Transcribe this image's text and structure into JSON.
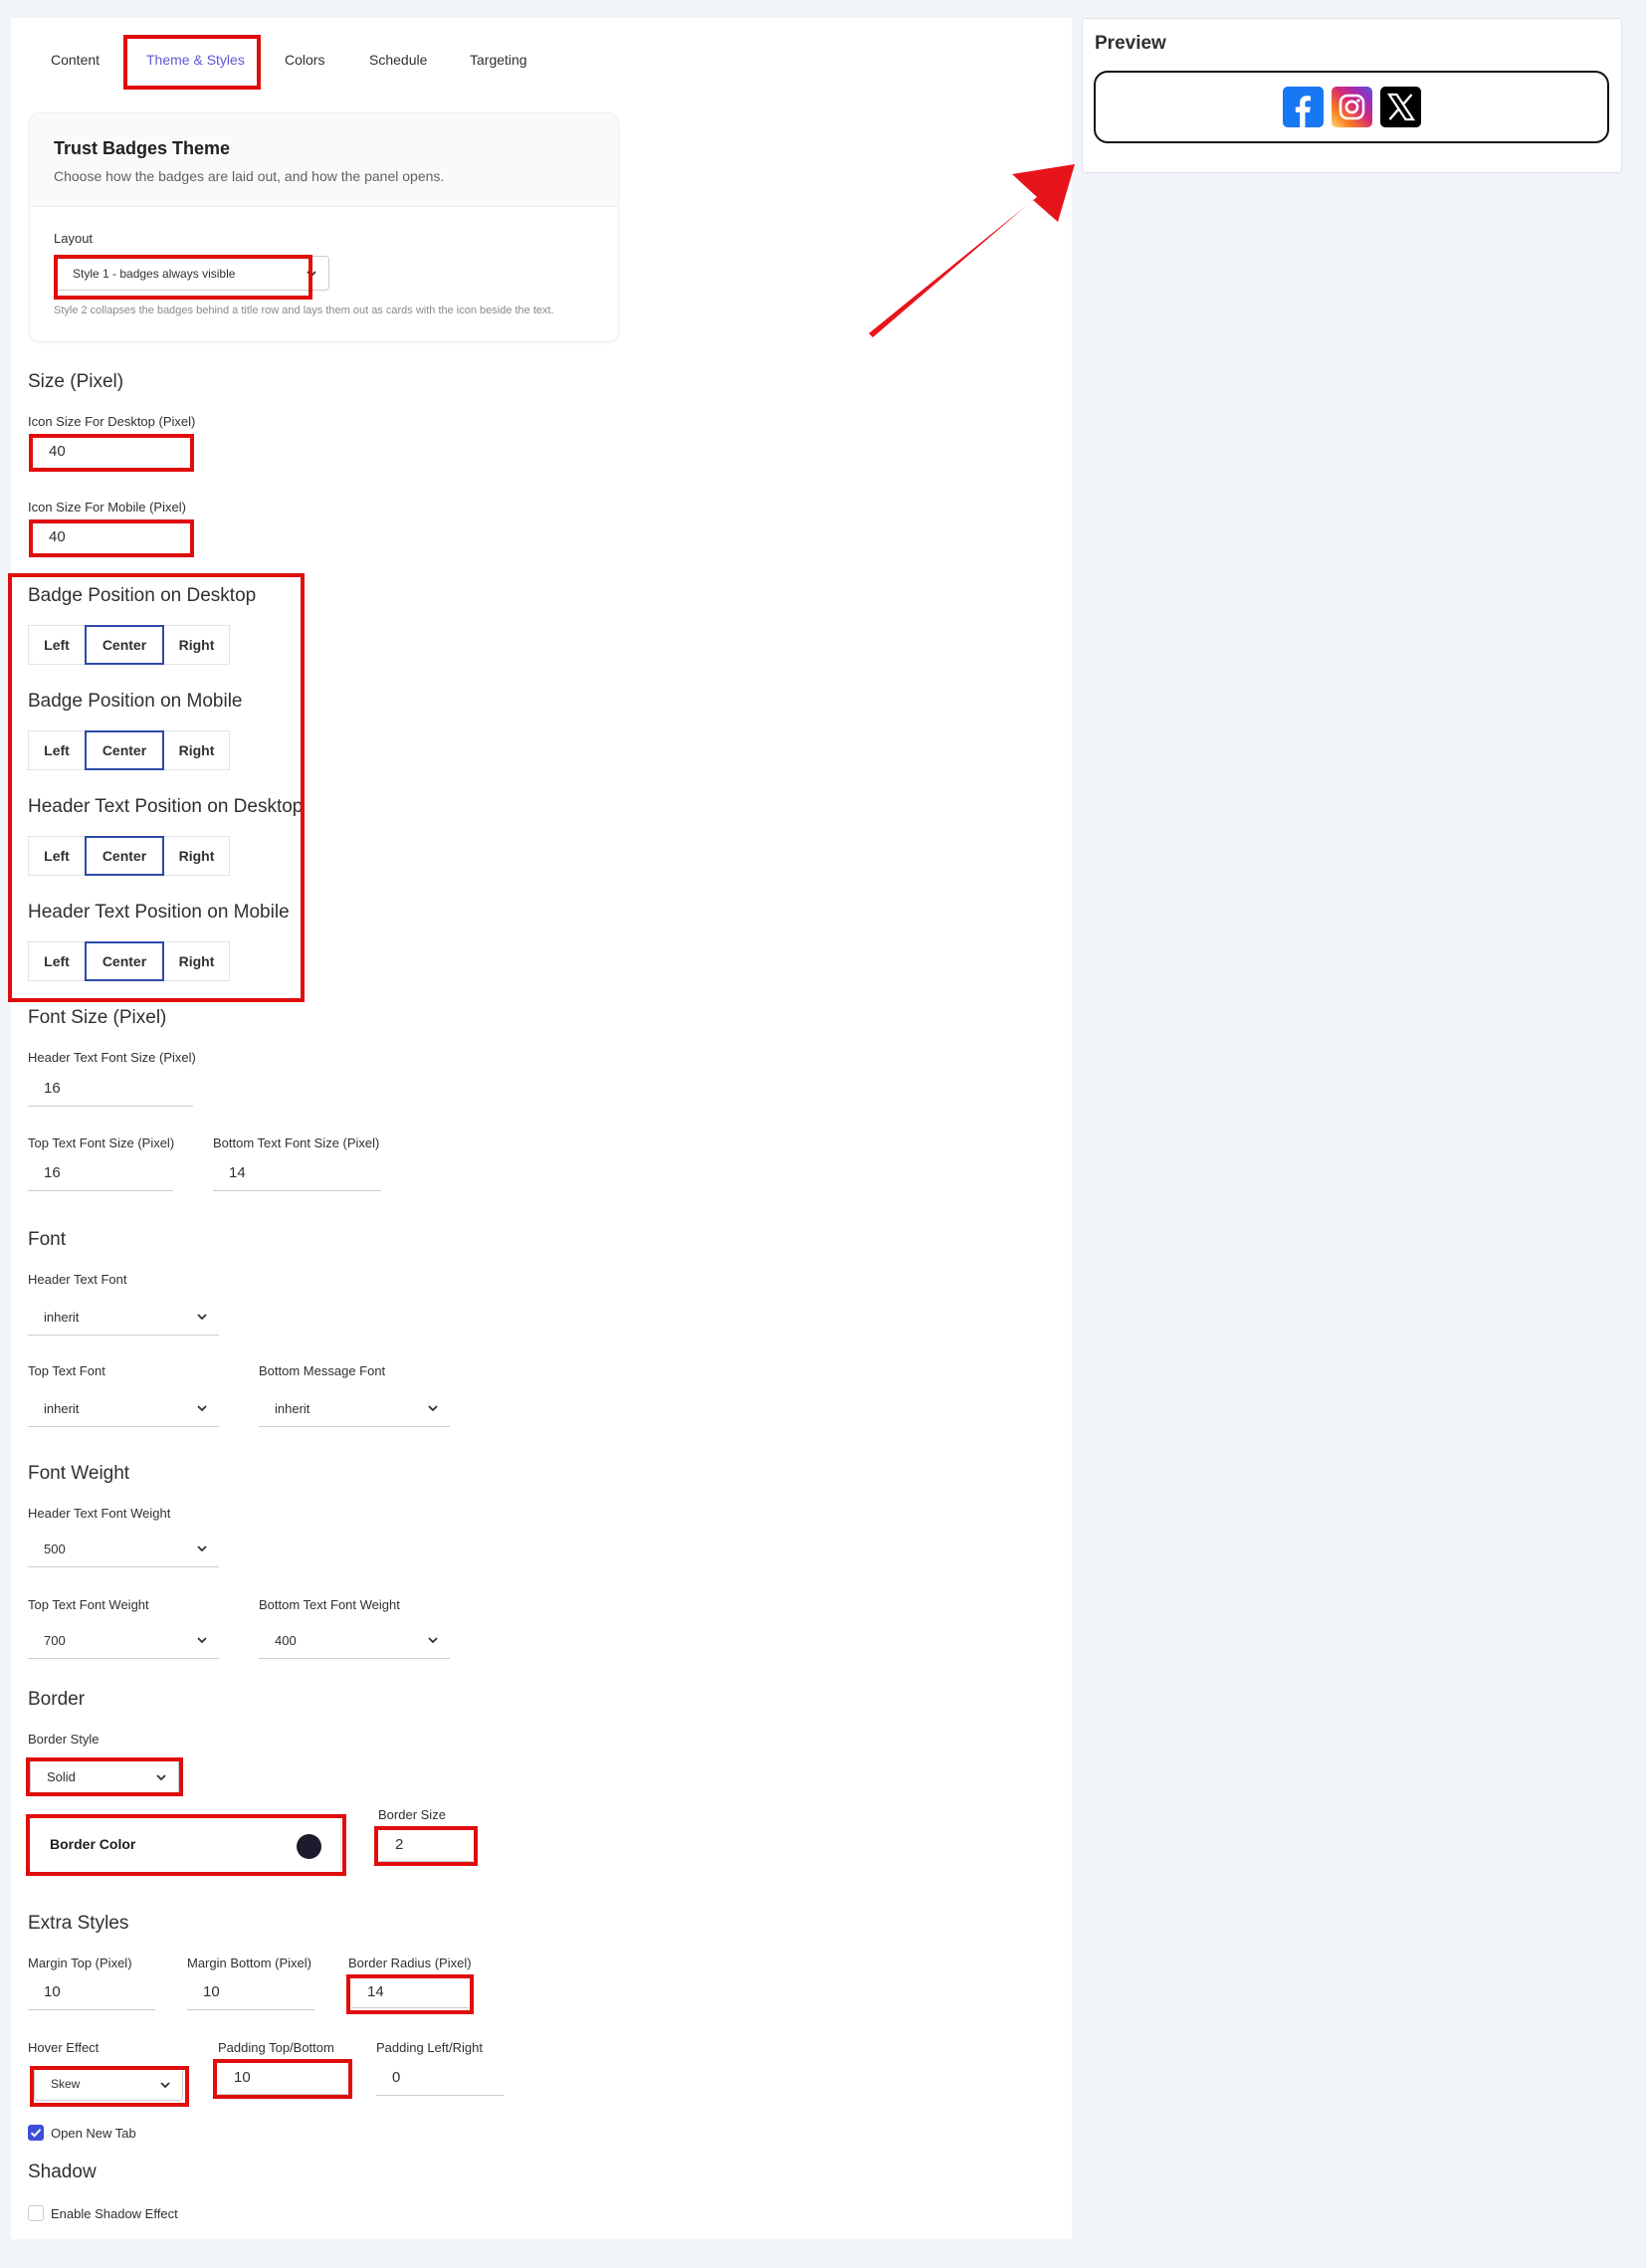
{
  "tabs": [
    {
      "label": "Content"
    },
    {
      "label": "Theme & Styles",
      "active": true
    },
    {
      "label": "Colors"
    },
    {
      "label": "Schedule"
    },
    {
      "label": "Targeting"
    }
  ],
  "theme_card": {
    "title": "Trust Badges Theme",
    "description": "Choose how the badges are laid out, and how the panel opens.",
    "layout_label": "Layout",
    "layout_value": "Style 1 - badges always visible",
    "layout_help": "Style 2 collapses the badges behind a title row and lays them out as cards with the icon beside the text."
  },
  "size": {
    "heading": "Size (Pixel)",
    "desktop_label": "Icon Size For Desktop (Pixel)",
    "desktop_value": "40",
    "mobile_label": "Icon Size For Mobile (Pixel)",
    "mobile_value": "40"
  },
  "positions": [
    {
      "heading": "Badge Position on Desktop",
      "options": [
        "Left",
        "Center",
        "Right"
      ],
      "selected": "Center"
    },
    {
      "heading": "Badge Position on Mobile",
      "options": [
        "Left",
        "Center",
        "Right"
      ],
      "selected": "Center"
    },
    {
      "heading": "Header Text Position on Desktop",
      "options": [
        "Left",
        "Center",
        "Right"
      ],
      "selected": "Center"
    },
    {
      "heading": "Header Text Position on Mobile",
      "options": [
        "Left",
        "Center",
        "Right"
      ],
      "selected": "Center"
    }
  ],
  "font_size": {
    "heading": "Font Size (Pixel)",
    "header_label": "Header Text Font Size (Pixel)",
    "header_value": "16",
    "top_label": "Top Text Font Size (Pixel)",
    "top_value": "16",
    "bottom_label": "Bottom Text Font Size (Pixel)",
    "bottom_value": "14"
  },
  "font": {
    "heading": "Font",
    "header_label": "Header Text Font",
    "header_value": "inherit",
    "top_label": "Top Text Font",
    "top_value": "inherit",
    "bottom_label": "Bottom Message Font",
    "bottom_value": "inherit"
  },
  "font_weight": {
    "heading": "Font Weight",
    "header_label": "Header Text Font Weight",
    "header_value": "500",
    "top_label": "Top Text Font Weight",
    "top_value": "700",
    "bottom_label": "Bottom Text Font Weight",
    "bottom_value": "400"
  },
  "border": {
    "heading": "Border",
    "style_label": "Border Style",
    "style_value": "Solid",
    "color_label": "Border Color",
    "color_value": "#1c1a2c",
    "size_label": "Border Size",
    "size_value": "2"
  },
  "extra": {
    "heading": "Extra Styles",
    "margin_top_label": "Margin Top (Pixel)",
    "margin_top_value": "10",
    "margin_bottom_label": "Margin Bottom (Pixel)",
    "margin_bottom_value": "10",
    "radius_label": "Border Radius (Pixel)",
    "radius_value": "14",
    "hover_label": "Hover Effect",
    "hover_value": "Skew",
    "pad_tb_label": "Padding Top/Bottom",
    "pad_tb_value": "10",
    "pad_lr_label": "Padding Left/Right",
    "pad_lr_value": "0",
    "new_tab_label": "Open New Tab",
    "new_tab_checked": true
  },
  "shadow": {
    "heading": "Shadow",
    "enable_label": "Enable Shadow Effect",
    "enable_checked": false
  },
  "preview": {
    "title": "Preview",
    "badges": [
      {
        "icon": "facebook-icon",
        "color": "#1877f2"
      },
      {
        "icon": "instagram-icon",
        "color": "#d62976"
      },
      {
        "icon": "x-icon",
        "color": "#000000"
      }
    ]
  },
  "colors": {
    "accent": "#5c5ad6",
    "selected_border": "#2b4aa8",
    "annotation_red": "#e10d0d",
    "checkbox": "#3d4fd6"
  }
}
